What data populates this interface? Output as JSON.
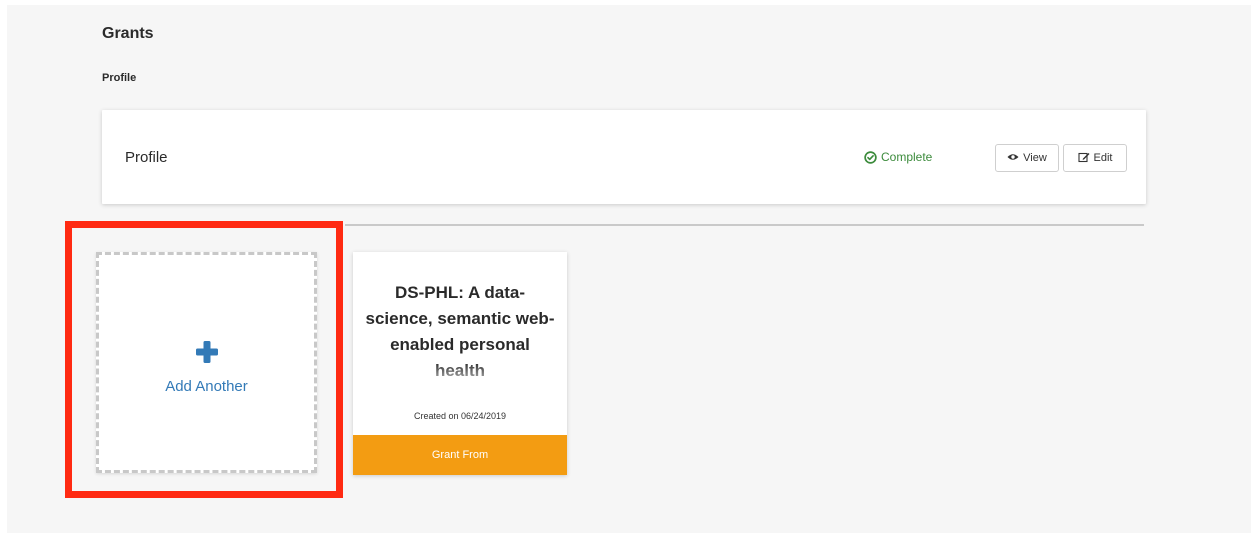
{
  "header": {
    "title": "Grants",
    "section_label": "Profile"
  },
  "profile": {
    "name": "Profile",
    "status_text": "Complete",
    "status_icon": "check-circle-icon",
    "status_color": "#3c8b3c",
    "view_label": "View",
    "view_icon": "eye-icon",
    "edit_label": "Edit",
    "edit_icon": "edit-icon"
  },
  "add_card": {
    "label": "Add Another",
    "icon": "plus-icon",
    "accent_color": "#337ab7",
    "highlight_color": "#ff2a12"
  },
  "grant_card": {
    "title": "DS-PHL: A data-science, semantic web-enabled personal health",
    "created": "Created on 06/24/2019",
    "footer_label": "Grant From",
    "footer_color": "#f39c12"
  }
}
